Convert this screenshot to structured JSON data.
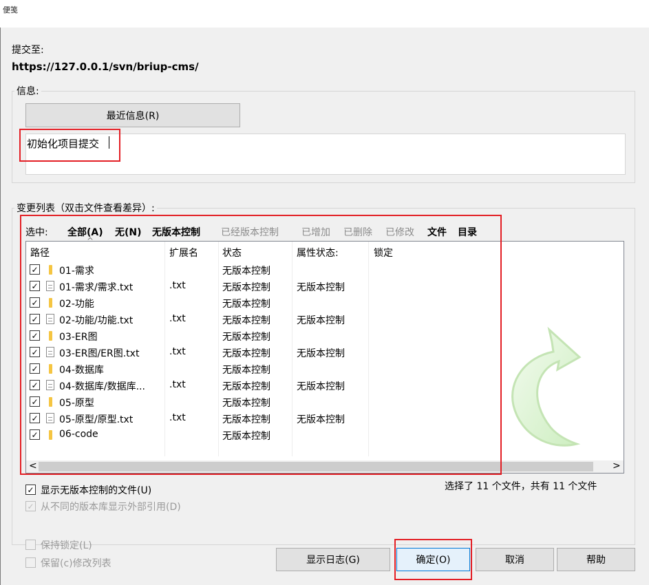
{
  "window": {
    "caption": "便笺"
  },
  "commit_to": {
    "label": "提交至:",
    "url": "https://127.0.0.1/svn/briup-cms/"
  },
  "message": {
    "legend": "信息:",
    "recent_button": "最近信息(R)",
    "text": "初始化项目提交"
  },
  "changes": {
    "legend": "变更列表（双击文件查看差异）:",
    "filter": {
      "label": "选中:",
      "all": "全部(A)",
      "none": "无(N)",
      "unversioned": "无版本控制",
      "versioned": "已经版本控制",
      "added": "已增加",
      "deleted": "已删除",
      "modified": "已修改",
      "files": "文件",
      "dirs": "目录"
    },
    "columns": {
      "path": "路径",
      "ext": "扩展名",
      "status": "状态",
      "prop_status": "属性状态:",
      "lock": "锁定"
    },
    "rows": [
      {
        "path": "01-需求",
        "type": "folder",
        "ext": "",
        "status": "无版本控制",
        "prop": ""
      },
      {
        "path": "01-需求/需求.txt",
        "type": "file",
        "ext": ".txt",
        "status": "无版本控制",
        "prop": "无版本控制"
      },
      {
        "path": "02-功能",
        "type": "folder",
        "ext": "",
        "status": "无版本控制",
        "prop": ""
      },
      {
        "path": "02-功能/功能.txt",
        "type": "file",
        "ext": ".txt",
        "status": "无版本控制",
        "prop": "无版本控制"
      },
      {
        "path": "03-ER图",
        "type": "folder",
        "ext": "",
        "status": "无版本控制",
        "prop": ""
      },
      {
        "path": "03-ER图/ER图.txt",
        "type": "file",
        "ext": ".txt",
        "status": "无版本控制",
        "prop": "无版本控制"
      },
      {
        "path": "04-数据库",
        "type": "folder",
        "ext": "",
        "status": "无版本控制",
        "prop": ""
      },
      {
        "path": "04-数据库/数据库...",
        "type": "file",
        "ext": ".txt",
        "status": "无版本控制",
        "prop": "无版本控制"
      },
      {
        "path": "05-原型",
        "type": "folder",
        "ext": "",
        "status": "无版本控制",
        "prop": ""
      },
      {
        "path": "05-原型/原型.txt",
        "type": "file",
        "ext": ".txt",
        "status": "无版本控制",
        "prop": "无版本控制"
      },
      {
        "path": "06-code",
        "type": "folder",
        "ext": "",
        "status": "无版本控制",
        "prop": ""
      }
    ],
    "summary": "选择了 11 个文件，共有 11 个文件"
  },
  "options": {
    "show_unversioned": "显示无版本控制的文件(U)",
    "show_externals": "从不同的版本库显示外部引用(D)",
    "keep_locks": "保持锁定(L)",
    "keep_changelist": "保留(c)修改列表"
  },
  "buttons": {
    "show_log": "显示日志(G)",
    "ok": "确定(O)",
    "cancel": "取消",
    "help": "帮助"
  },
  "colors": {
    "highlight": "#e31e24",
    "arrow": "#cdeec0"
  }
}
